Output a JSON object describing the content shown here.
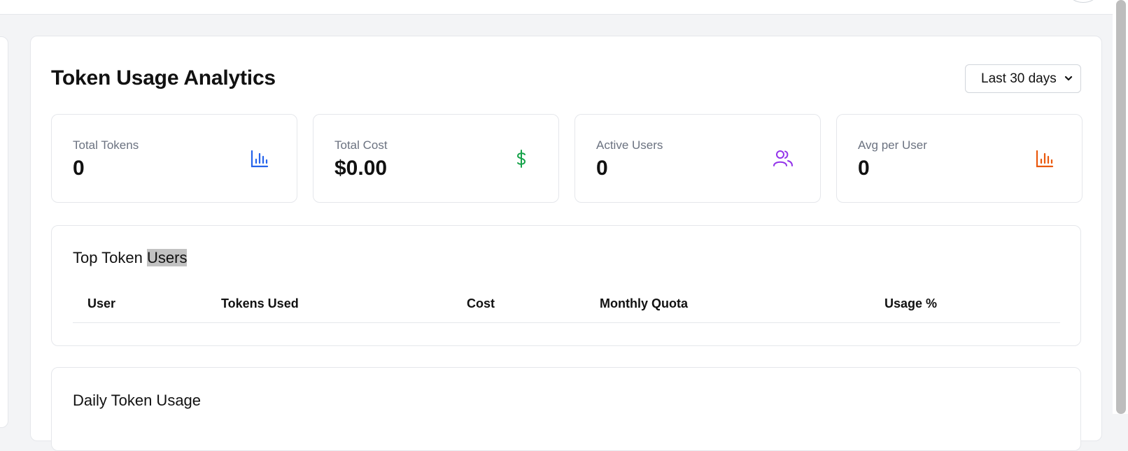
{
  "page": {
    "title": "Token Usage Analytics",
    "range_select": {
      "value": "Last 30 days"
    }
  },
  "stats": [
    {
      "label": "Total Tokens",
      "value": "0",
      "icon": "bar-chart-icon",
      "icon_color": "#2563eb"
    },
    {
      "label": "Total Cost",
      "value": "$0.00",
      "icon": "dollar-icon",
      "icon_color": "#16a34a"
    },
    {
      "label": "Active Users",
      "value": "0",
      "icon": "users-icon",
      "icon_color": "#9333ea"
    },
    {
      "label": "Avg per User",
      "value": "0",
      "icon": "bar-chart-icon",
      "icon_color": "#ea580c"
    }
  ],
  "top_users": {
    "title_prefix": "Top Token ",
    "title_highlight": "Users",
    "columns": [
      "User",
      "Tokens Used",
      "Cost",
      "Monthly Quota",
      "Usage %"
    ]
  },
  "daily_usage": {
    "title": "Daily Token Usage"
  }
}
